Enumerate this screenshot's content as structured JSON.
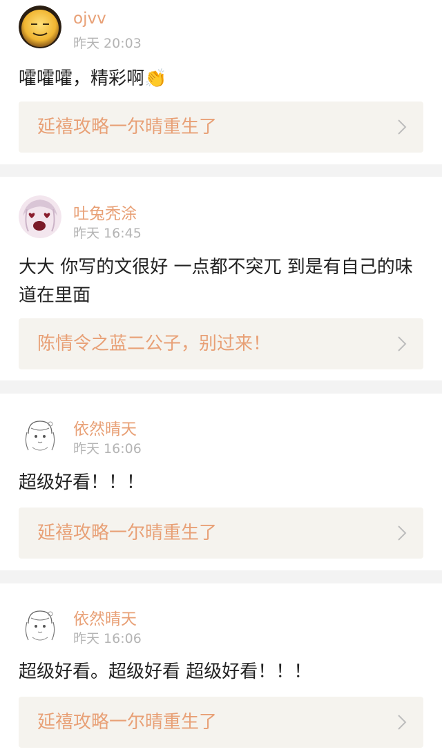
{
  "comments": [
    {
      "username": "ojvv",
      "time": "昨天 20:03",
      "text": "嚯嚯嚯，精彩啊",
      "emoji": "👏",
      "avatar_icon": "smiley-face-avatar",
      "link": {
        "title": "延禧攻略一尔晴重生了"
      }
    },
    {
      "username": "吐兔秃涂",
      "time": "昨天 16:45",
      "text": "大大 你写的文很好 一点都不突兀 到是有自己的味道在里面",
      "avatar_icon": "heart-eyes-avatar",
      "link": {
        "title": "陈情令之蓝二公子，别过来！"
      }
    },
    {
      "username": "依然晴天",
      "time": "昨天 16:06",
      "text": "超级好看！！！",
      "avatar_icon": "sketch-girl-avatar",
      "link": {
        "title": "延禧攻略一尔晴重生了"
      }
    },
    {
      "username": "依然晴天",
      "time": "昨天 16:06",
      "text": "超级好看。超级好看 超级好看！！！",
      "avatar_icon": "sketch-girl-avatar",
      "link": {
        "title": "延禧攻略一尔晴重生了"
      }
    }
  ],
  "colors": {
    "accent": "#e8a076",
    "timestamp": "#b4b4b4",
    "link_bg": "#f5f3ee",
    "separator": "#f3f3f3"
  }
}
